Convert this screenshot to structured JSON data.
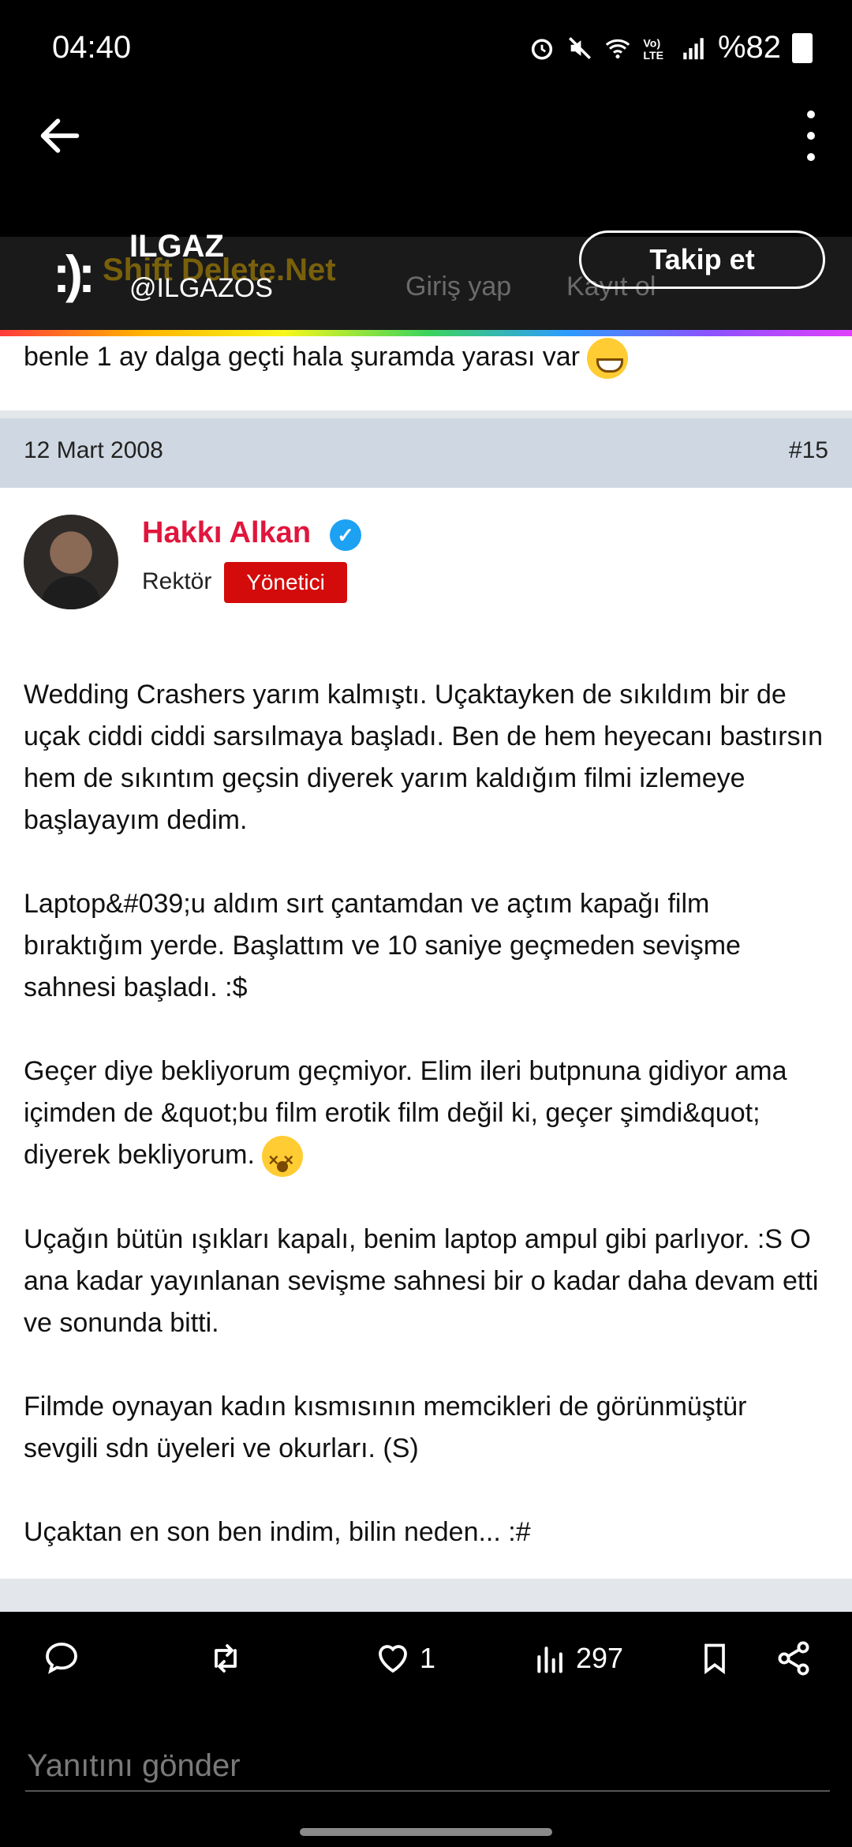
{
  "status_bar": {
    "time": "04:40",
    "battery": "%82",
    "icons": [
      "alarm-icon",
      "mute-icon",
      "wifi-icon",
      "volte-icon",
      "signal-icon",
      "battery-icon"
    ]
  },
  "header": {
    "account_name": "ILGAZ",
    "account_handle": "@ILGAZOS",
    "follow_label": "Takip et",
    "logo_text": ":):"
  },
  "site": {
    "brand": "Shift Delete.Net",
    "nav": [
      "Giriş yap",
      "Kayıt ol"
    ]
  },
  "forum": {
    "prev_text": "benle 1 ay dalga geçti hala şuramda yarası var",
    "post": {
      "date": "12 Mart 2008",
      "number": "#15",
      "author": "Hakkı Alkan",
      "role": "Rektör",
      "badge": "Yönetici",
      "paragraphs": [
        "Wedding Crashers yarım kalmıştı. Uçaktayken de sıkıldım bir de uçak ciddi ciddi sarsılmaya başladı. Ben de hem heyecanı bastırsın hem de sıkıntım geçsin diyerek yarım kaldığım filmi izlemeye başlayayım dedim.",
        "Laptop&#039;u aldım sırt çantamdan ve açtım kapağı film bıraktığım yerde. Başlattım ve 10 saniye geçmeden sevişme sahnesi başladı. :$",
        "Geçer diye bekliyorum geçmiyor. Elim ileri butpnuna gidiyor ama içimden de &quot;bu film erotik film değil ki, geçer şimdi&quot; diyerek bekliyorum.",
        "Uçağın bütün ışıkları kapalı, benim laptop ampul gibi parlıyor. :S O ana kadar yayınlanan sevişme sahnesi bir o kadar daha devam etti ve sonunda bitti.",
        "Filmde oynayan kadın kısmısının memcikleri de görünmüştür sevgili sdn üyeleri ve okurları. (S)",
        "Uçaktan en son ben indim, bilin neden... :#"
      ]
    }
  },
  "actions": {
    "likes": "1",
    "views": "297"
  },
  "reply": {
    "placeholder": "Yanıtını gönder"
  },
  "colors": {
    "accent_red": "#e0163d",
    "badge_red": "#d40b0b",
    "verified_blue": "#1da1f2"
  }
}
